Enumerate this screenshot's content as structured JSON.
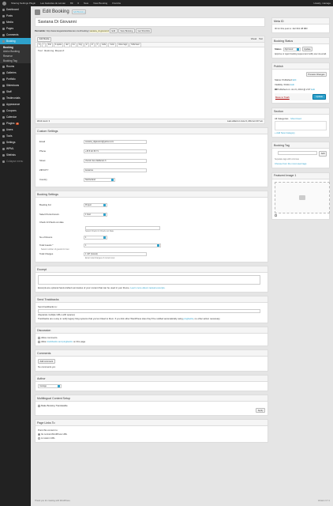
{
  "adminbar": {
    "items": [
      "Sharing Settings Plugin",
      "Les Gazettes du Léman",
      "89",
      "0",
      "New",
      "View Booking",
      "Französ"
    ],
    "howdy": "Howdy, manage"
  },
  "menu": {
    "items_top": [
      {
        "label": "Dashboard",
        "icon": "dashboard-icon"
      },
      {
        "label": "Posts",
        "icon": "pin-icon"
      },
      {
        "label": "Media",
        "icon": "media-icon"
      },
      {
        "label": "Pages",
        "icon": "page-icon"
      },
      {
        "label": "Comments",
        "icon": "comment-icon"
      }
    ],
    "active": {
      "label": "Booking",
      "icon": "booking-icon"
    },
    "submenu": [
      "Booking",
      "Add a Booking",
      "Reserve",
      "Booking Tag"
    ],
    "items_bottom": [
      {
        "label": "Rooms",
        "icon": "room-icon"
      },
      {
        "label": "Galleries",
        "icon": "gallery-icon"
      },
      {
        "label": "Portfolio",
        "icon": "portfolio-icon"
      },
      {
        "label": "Slideshows",
        "icon": "slideshow-icon"
      },
      {
        "label": "Staff",
        "icon": "staff-icon"
      },
      {
        "label": "Testimonials",
        "icon": "testimonial-icon"
      },
      {
        "label": "Appearance",
        "icon": "appearance-icon"
      },
      {
        "label": "Coupons",
        "icon": "coupon-icon"
      },
      {
        "label": "Calendar",
        "icon": "calendar-icon"
      },
      {
        "label": "Plugins",
        "icon": "plugin-icon",
        "badge": "2"
      },
      {
        "label": "Users",
        "icon": "users-icon"
      },
      {
        "label": "Tools",
        "icon": "tools-icon"
      },
      {
        "label": "Settings",
        "icon": "settings-icon"
      },
      {
        "label": "WPML",
        "icon": "wpml-icon"
      },
      {
        "label": "Sitelinks",
        "icon": "sitelinks-icon"
      }
    ],
    "collapse": "Collapse menu"
  },
  "page": {
    "heading": "Edit Booking",
    "add_new": "Add Booking",
    "title_value": "Saviana Di Giovanni",
    "permalink_label": "Permalink:",
    "permalink_url": "http://www.lesgazettesduleman.com/booking/",
    "permalink_slug": "saviana_di-giovanni/",
    "edit_btn": "Edit",
    "view_btn": "View Booking",
    "shortlink_btn": "Get Shortlink"
  },
  "editor": {
    "add_media": "Add Media",
    "visual": "Visual",
    "text": "Text",
    "quicktags": [
      "b",
      "i",
      "link",
      "b-quote",
      "del",
      "ins",
      "img",
      "ul",
      "ol",
      "li",
      "code",
      "more",
      "close tags",
      "fullscreen"
    ],
    "content": "Tour Booking Request",
    "word_count": "Word count: 3",
    "last_edited": "Last edited on June 9, 2014 at 2:07 am"
  },
  "custom_settings": {
    "title": "Custom Settings",
    "fields": [
      {
        "label": "Email",
        "value": "saviana_digiovanni@yahoo.com"
      },
      {
        "label": "Phone",
        "value": "+33 6 42 33 71"
      },
      {
        "label": "Street",
        "value": "chemin des diablerets 3"
      },
      {
        "label": "ZIP/CITY",
        "value": "lausanne"
      },
      {
        "label": "Country",
        "value": "Switzerland"
      }
    ]
  },
  "booking_settings": {
    "title": "Booking Settings",
    "booking_for_label": "Booking For",
    "booking_for_value": "Project",
    "select_period_label": "Select Period Hours",
    "select_period_value": "1 hour",
    "checkin_label": "Check In/Check out date",
    "checkin_note": "Select Check in/ Check out Date",
    "rooms_label": "No of Rooms",
    "rooms_value": "1",
    "total_guests_label": "Total Guests *",
    "total_guests_value": "1",
    "total_guests_note": "Select number of guests for tour.",
    "total_charges_label": "Total Charges",
    "total_charges_value": "1 447 (Grand)",
    "total_charges_note": "Enter total charges of current tour."
  },
  "excerpt": {
    "title": "Excerpt",
    "help": "Excerpts are optional hand-crafted summaries of your content that can be used in your theme.",
    "link": "Learn more about manual excerpts."
  },
  "trackbacks": {
    "title": "Send Trackbacks",
    "send_to": "Send trackbacks to:",
    "separate": "(Separate multiple URLs with spaces)",
    "help": "Trackbacks are a way to notify legacy blog systems that you've linked to them. If you link other WordPress sites they'll be notified automatically using",
    "pingbacks": "pingbacks",
    "help2": ", no other action necessary."
  },
  "discussion": {
    "title": "Discussion",
    "allow_comments": "Allow comments.",
    "allow_pings_pre": "Allow",
    "allow_pings_link": "trackbacks and pingbacks",
    "allow_pings_post": "on this page."
  },
  "comments": {
    "title": "Comments",
    "add_btn": "Add comment",
    "none": "No comments yet."
  },
  "author": {
    "title": "Author",
    "value": "manage"
  },
  "multilingual": {
    "title": "Multilingual Content Setup",
    "checkbox": "Make Booking Translatable",
    "apply": "Apply"
  },
  "page_links_to": {
    "title": "Page Links To",
    "point_to": "Point this content to:",
    "option1": "Its normal WordPress URL",
    "option2": "A custom URL"
  },
  "sidebar": {
    "wpml": {
      "title": "Meta ID",
      "text": "ID for this post is: 112 601 08 883"
    },
    "booking_status": {
      "title": "Booking Status",
      "status_label": "Status",
      "status_value": "Approved",
      "update": "Update",
      "note": "Approve or reject booking request and notify user via email."
    },
    "publish": {
      "title": "Publish",
      "preview": "Preview Changes",
      "status": "Status: Published",
      "status_edit": "Edit",
      "visibility": "Visibility: Public",
      "visibility_edit": "Edit",
      "published_on": "Published on: Jun 9, 2014 @ 2:07",
      "published_edit": "Edit",
      "trash": "Move to Trash",
      "update": "Update"
    },
    "section": {
      "title": "Section",
      "tab_all": "All Categories",
      "tab_used": "Most Used",
      "add": "+ Add New Category"
    },
    "booking_tag": {
      "title": "Booking Tag",
      "add": "Add",
      "note": "Separate tags with commas",
      "choose": "Choose from the most used tags"
    },
    "featured": {
      "title": "Featured Image 1"
    }
  },
  "footer": {
    "thanks": "Thank you for creating with WordPress.",
    "version": "Version 3.7.1"
  }
}
